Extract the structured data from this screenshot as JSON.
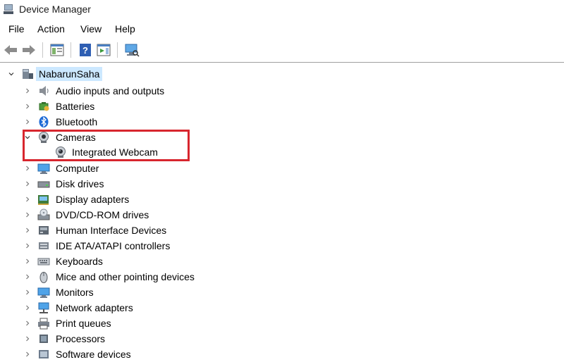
{
  "window": {
    "title": "Device Manager"
  },
  "menu": {
    "items": [
      "File",
      "Action",
      "View",
      "Help"
    ]
  },
  "tree": {
    "root": {
      "label": "NabarunSaha"
    },
    "categories": [
      "Audio inputs and outputs",
      "Batteries",
      "Bluetooth",
      "Cameras",
      "Computer",
      "Disk drives",
      "Display adapters",
      "DVD/CD-ROM drives",
      "Human Interface Devices",
      "IDE ATA/ATAPI controllers",
      "Keyboards",
      "Mice and other pointing devices",
      "Monitors",
      "Network adapters",
      "Print queues",
      "Processors",
      "Software devices"
    ],
    "camera_child": "Integrated Webcam"
  },
  "colors": {
    "highlight_border": "#d8262e",
    "selection": "#cce8ff"
  }
}
